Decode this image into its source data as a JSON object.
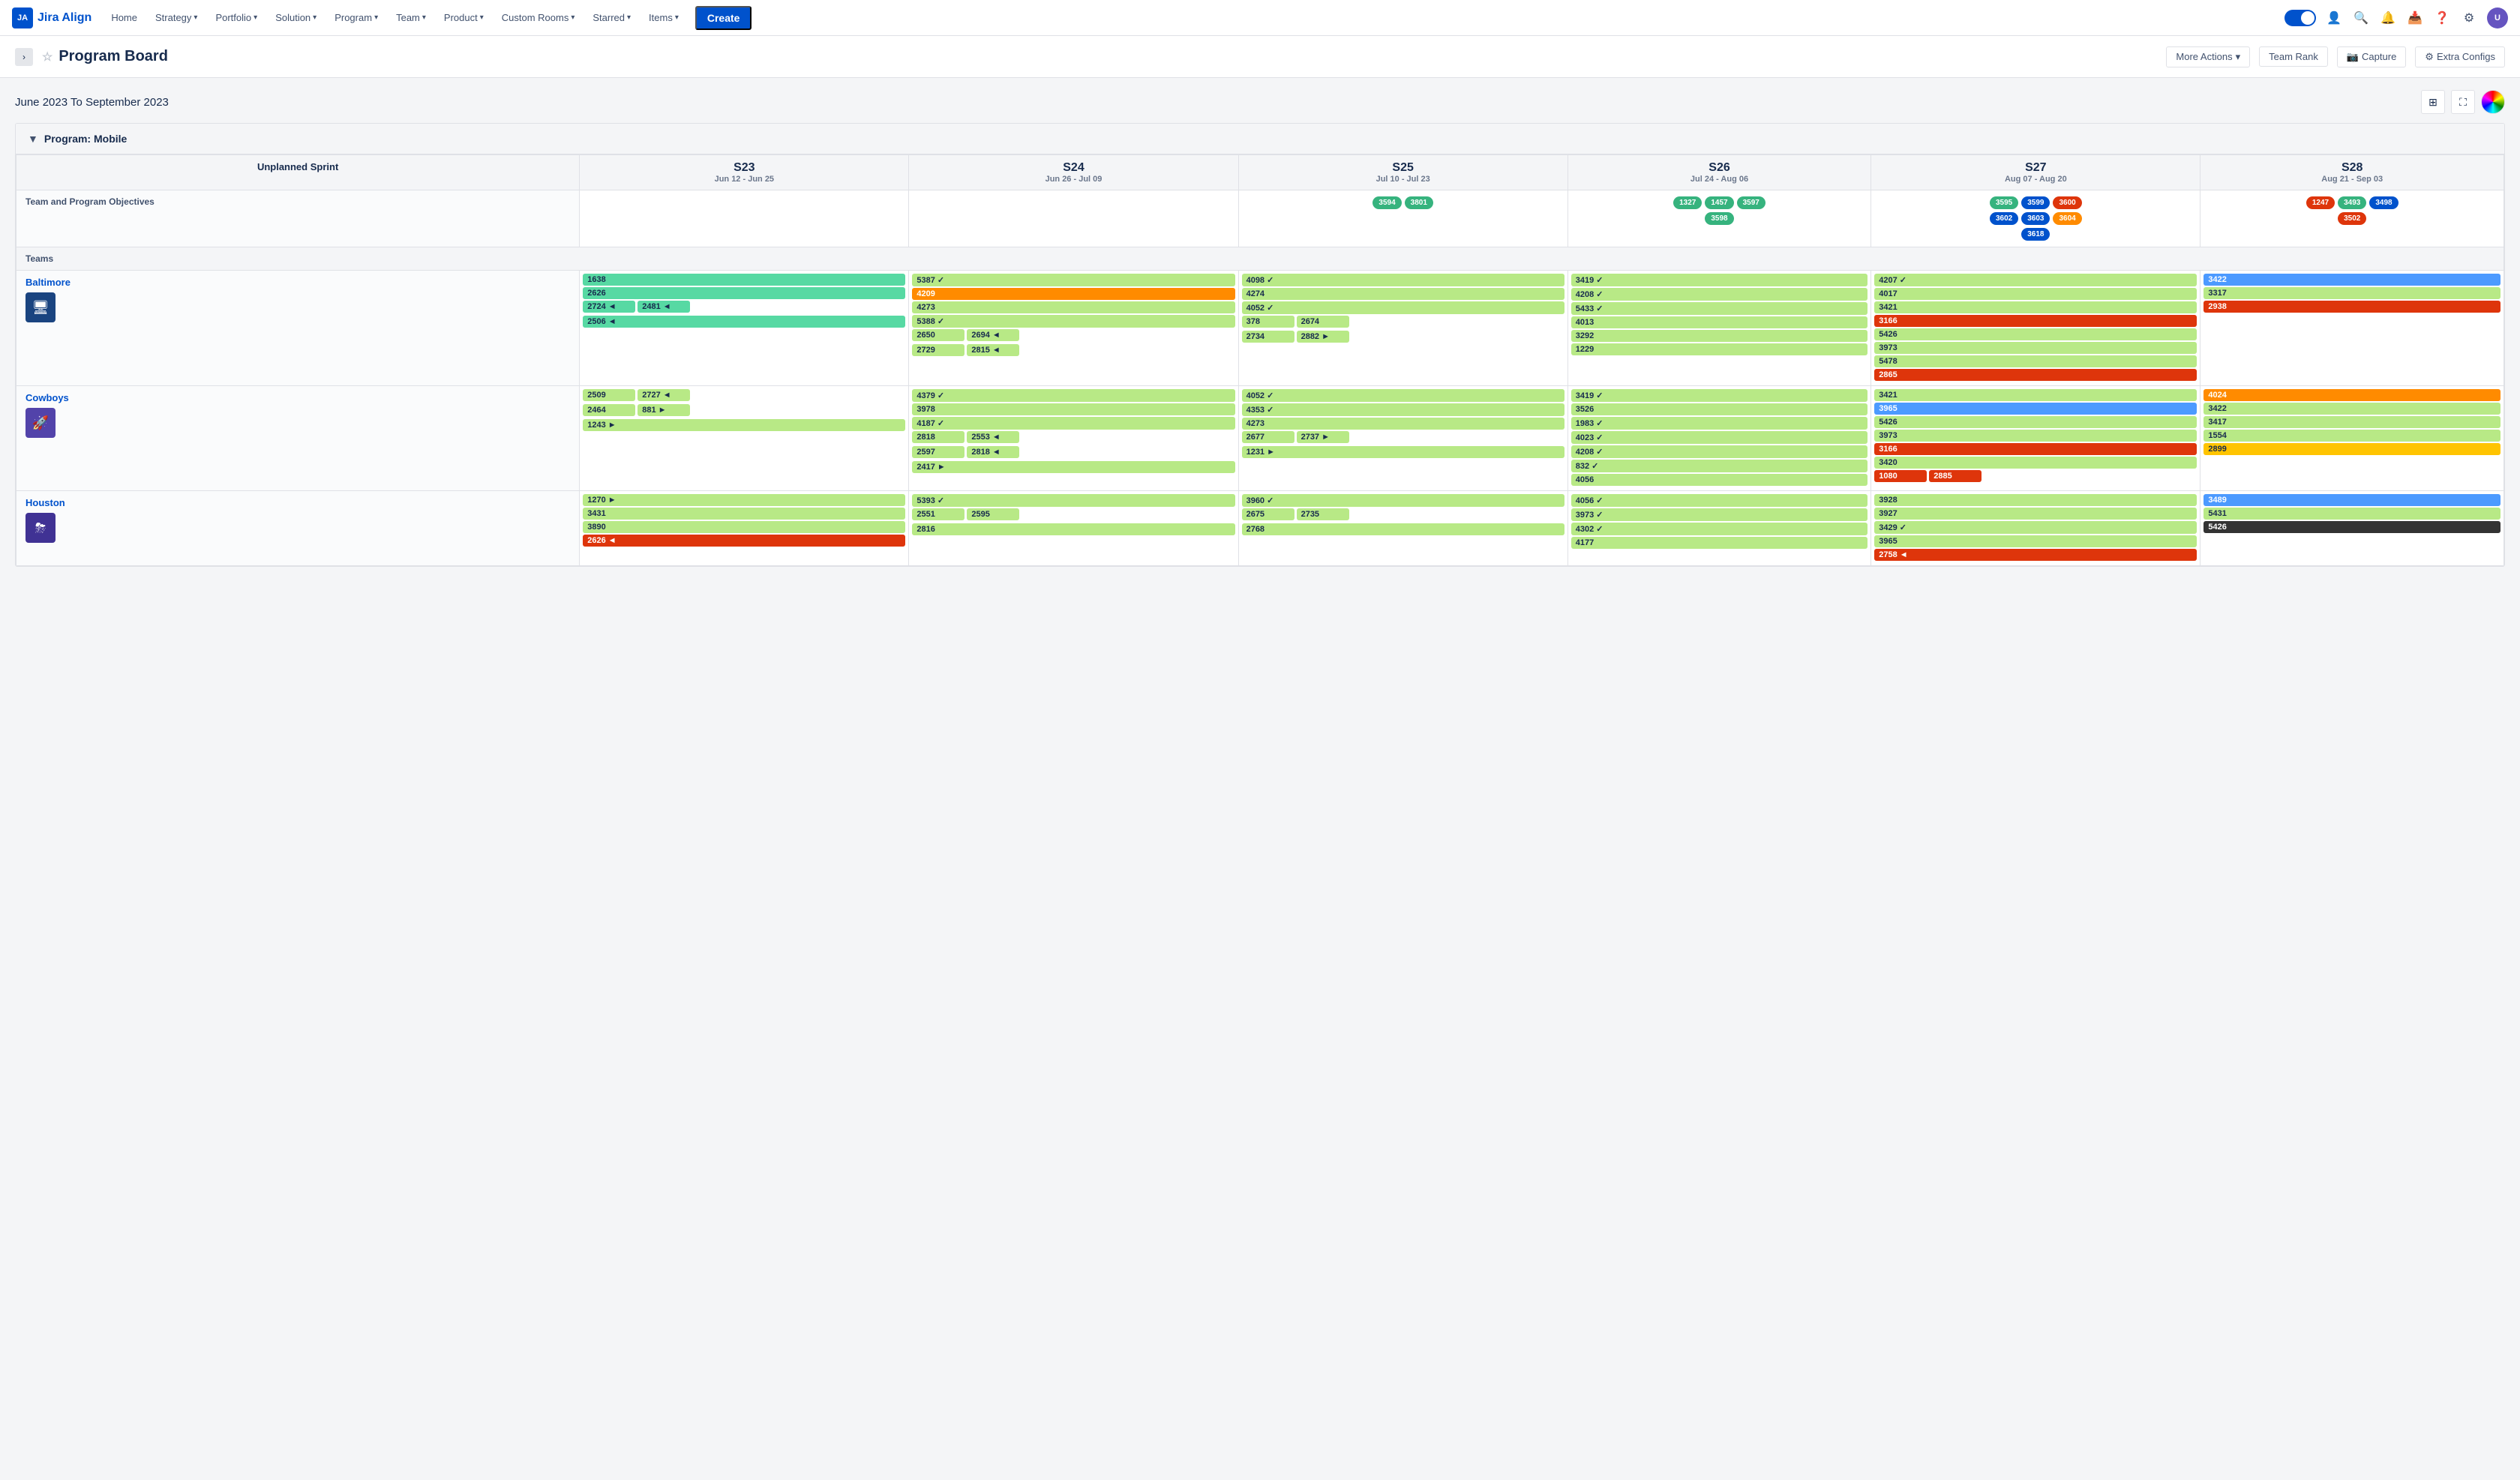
{
  "nav": {
    "logo_text": "Jira Align",
    "items": [
      {
        "label": "Home",
        "has_dropdown": false
      },
      {
        "label": "Strategy",
        "has_dropdown": true
      },
      {
        "label": "Portfolio",
        "has_dropdown": true
      },
      {
        "label": "Solution",
        "has_dropdown": true
      },
      {
        "label": "Program",
        "has_dropdown": true
      },
      {
        "label": "Team",
        "has_dropdown": true
      },
      {
        "label": "Product",
        "has_dropdown": true
      },
      {
        "label": "Custom Rooms",
        "has_dropdown": true
      },
      {
        "label": "Starred",
        "has_dropdown": true
      },
      {
        "label": "Items",
        "has_dropdown": true
      }
    ],
    "create_label": "Create"
  },
  "page": {
    "title": "Program Board",
    "more_actions": "More Actions",
    "team_rank": "Team Rank",
    "capture": "Capture",
    "extra_configs": "Extra Configs"
  },
  "date_range": "June 2023 To September 2023",
  "program_label": "Program: Mobile",
  "sprints": [
    {
      "code": "S23",
      "dates": "Jun 12 - Jun 25"
    },
    {
      "code": "S24",
      "dates": "Jun 26 - Jul 09"
    },
    {
      "code": "S25",
      "dates": "Jul 10 - Jul 23"
    },
    {
      "code": "S26",
      "dates": "Jul 24 - Aug 06"
    },
    {
      "code": "S27",
      "dates": "Aug 07 - Aug 20"
    },
    {
      "code": "S28",
      "dates": "Aug 21 - Sep 03"
    }
  ],
  "unplanned_sprint_label": "Unplanned Sprint",
  "sections": {
    "objectives_label": "Team and Program Objectives",
    "teams_label": "Teams"
  },
  "objectives": {
    "s23": [],
    "s24": [],
    "s25": [
      {
        "id": "3594",
        "color": "green"
      },
      {
        "id": "3801",
        "color": "green"
      }
    ],
    "s26": [
      {
        "id": "1327",
        "color": "green"
      },
      {
        "id": "1457",
        "color": "green"
      },
      {
        "id": "3597",
        "color": "green"
      },
      {
        "id": "3598",
        "color": "green"
      }
    ],
    "s27": [
      {
        "id": "3595",
        "color": "green"
      },
      {
        "id": "3599",
        "color": "blue"
      },
      {
        "id": "3600",
        "color": "red"
      },
      {
        "id": "3602",
        "color": "blue"
      },
      {
        "id": "3603",
        "color": "blue"
      },
      {
        "id": "3604",
        "color": "orange"
      },
      {
        "id": "3618",
        "color": "blue"
      }
    ],
    "s28": [
      {
        "id": "1247",
        "color": "red"
      },
      {
        "id": "3493",
        "color": "green"
      },
      {
        "id": "3498",
        "color": "blue"
      },
      {
        "id": "3502",
        "color": "red"
      }
    ]
  },
  "teams": [
    {
      "name": "Baltimore",
      "avatar_icon": "🖥",
      "avatar_color": "dark-blue",
      "sprints": {
        "s23": [
          [
            {
              "id": "1638",
              "color": "green"
            }
          ],
          [
            {
              "id": "2626",
              "color": "green"
            }
          ],
          [
            {
              "id": "2724",
              "color": "green"
            },
            {
              "id": "2481",
              "color": "green"
            }
          ],
          [
            {
              "id": "2506",
              "color": "green",
              "arrow": "◄"
            }
          ]
        ],
        "s24": [
          [
            {
              "id": "5387",
              "color": "lime",
              "arrow": "✓"
            }
          ],
          [
            {
              "id": "4209",
              "color": "orange"
            }
          ],
          [
            {
              "id": "4273",
              "color": "lime"
            }
          ],
          [
            {
              "id": "5388",
              "color": "lime",
              "arrow": "✓"
            }
          ],
          [
            {
              "id": "2650",
              "color": "lime"
            },
            {
              "id": "2694",
              "color": "lime"
            }
          ],
          [
            {
              "id": "2729",
              "color": "lime"
            },
            {
              "id": "2815",
              "color": "lime"
            }
          ]
        ],
        "s25": [
          [
            {
              "id": "4098",
              "color": "lime",
              "arrow": "✓"
            }
          ],
          [
            {
              "id": "4274",
              "color": "lime"
            }
          ],
          [
            {
              "id": "4052",
              "color": "lime",
              "arrow": "✓"
            }
          ],
          [
            {
              "id": "378",
              "color": "lime"
            },
            {
              "id": "2674",
              "color": "lime"
            }
          ],
          [
            {
              "id": "2734",
              "color": "lime"
            },
            {
              "id": "2882",
              "color": "lime",
              "arrow": "►"
            }
          ]
        ],
        "s26": [
          [
            {
              "id": "3419",
              "color": "lime",
              "arrow": "✓"
            }
          ],
          [
            {
              "id": "4208",
              "color": "lime",
              "arrow": "✓"
            }
          ],
          [
            {
              "id": "5433",
              "color": "lime",
              "arrow": "✓"
            }
          ],
          [
            {
              "id": "4013",
              "color": "lime"
            }
          ],
          [
            {
              "id": "3292",
              "color": "lime"
            }
          ],
          [
            {
              "id": "1229",
              "color": "lime"
            }
          ]
        ],
        "s27": [
          [
            {
              "id": "4207",
              "color": "lime",
              "arrow": "✓"
            }
          ],
          [
            {
              "id": "4017",
              "color": "lime"
            }
          ],
          [
            {
              "id": "3421",
              "color": "lime"
            }
          ],
          [
            {
              "id": "3166",
              "color": "red"
            }
          ],
          [
            {
              "id": "5426",
              "color": "lime"
            }
          ],
          [
            {
              "id": "3973",
              "color": "lime"
            }
          ],
          [
            {
              "id": "5478",
              "color": "lime"
            }
          ],
          [
            {
              "id": "2865",
              "color": "red"
            }
          ]
        ],
        "s28": [
          [
            {
              "id": "3422",
              "color": "blue"
            }
          ],
          [
            {
              "id": "3317",
              "color": "lime"
            }
          ],
          [
            {
              "id": "2938",
              "color": "red"
            }
          ]
        ]
      }
    },
    {
      "name": "Cowboys",
      "avatar_icon": "🚀",
      "avatar_color": "purple",
      "sprints": {
        "s23": [
          [
            {
              "id": "2509",
              "color": "lime"
            },
            {
              "id": "2727",
              "color": "lime",
              "arrow": "◄"
            }
          ],
          [
            {
              "id": "2464",
              "color": "lime"
            },
            {
              "id": "881",
              "color": "lime",
              "arrow": "►"
            }
          ],
          [
            {
              "id": "1243",
              "color": "lime",
              "arrow": "►"
            }
          ]
        ],
        "s24": [
          [
            {
              "id": "4379",
              "color": "lime",
              "arrow": "✓"
            }
          ],
          [
            {
              "id": "3978",
              "color": "lime"
            }
          ],
          [
            {
              "id": "4187",
              "color": "lime",
              "arrow": "✓"
            }
          ],
          [
            {
              "id": "2818",
              "color": "lime"
            },
            {
              "id": "2553",
              "color": "lime"
            }
          ],
          [
            {
              "id": "2597",
              "color": "lime"
            },
            {
              "id": "2818",
              "color": "lime"
            }
          ],
          [
            {
              "id": "2417",
              "color": "lime",
              "arrow": "►"
            }
          ]
        ],
        "s25": [
          [
            {
              "id": "4052",
              "color": "lime",
              "arrow": "✓"
            }
          ],
          [
            {
              "id": "4353",
              "color": "lime",
              "arrow": "✓"
            }
          ],
          [
            {
              "id": "4273",
              "color": "lime"
            }
          ],
          [
            {
              "id": "2677",
              "color": "lime"
            },
            {
              "id": "2737",
              "color": "lime",
              "arrow": "►"
            }
          ],
          [
            {
              "id": "1231",
              "color": "lime",
              "arrow": "►"
            }
          ]
        ],
        "s26": [
          [
            {
              "id": "3419",
              "color": "lime",
              "arrow": "✓"
            }
          ],
          [
            {
              "id": "3526",
              "color": "lime"
            }
          ],
          [
            {
              "id": "1983",
              "color": "lime",
              "arrow": "✓"
            }
          ],
          [
            {
              "id": "4023",
              "color": "lime",
              "arrow": "✓"
            }
          ],
          [
            {
              "id": "4208",
              "color": "lime",
              "arrow": "✓"
            }
          ],
          [
            {
              "id": "832",
              "color": "lime",
              "arrow": "✓"
            }
          ],
          [
            {
              "id": "4056",
              "color": "lime"
            }
          ]
        ],
        "s27": [
          [
            {
              "id": "3421",
              "color": "lime"
            }
          ],
          [
            {
              "id": "3965",
              "color": "blue"
            }
          ],
          [
            {
              "id": "5426",
              "color": "lime"
            }
          ],
          [
            {
              "id": "3973",
              "color": "lime"
            }
          ],
          [
            {
              "id": "3166",
              "color": "red"
            }
          ],
          [
            {
              "id": "3420",
              "color": "lime"
            }
          ],
          [
            {
              "id": "1080",
              "color": "red"
            },
            {
              "id": "2885",
              "color": "red"
            }
          ]
        ],
        "s28": [
          [
            {
              "id": "4024",
              "color": "orange"
            }
          ],
          [
            {
              "id": "3422",
              "color": "lime"
            }
          ],
          [
            {
              "id": "3417",
              "color": "lime"
            }
          ],
          [
            {
              "id": "1554",
              "color": "lime"
            }
          ],
          [
            {
              "id": "2899",
              "color": "yellow"
            }
          ]
        ]
      }
    },
    {
      "name": "Houston",
      "avatar_icon": "⛈",
      "avatar_color": "indigo",
      "sprints": {
        "s23": [
          [
            {
              "id": "1270",
              "color": "lime",
              "arrow": "►"
            }
          ],
          [
            {
              "id": "3431",
              "color": "lime"
            }
          ],
          [
            {
              "id": "3890",
              "color": "lime"
            }
          ],
          [
            {
              "id": "2626",
              "color": "red",
              "arrow": "◄"
            }
          ]
        ],
        "s24": [
          [
            {
              "id": "5393",
              "color": "lime",
              "arrow": "✓"
            }
          ],
          [
            {
              "id": "2551",
              "color": "lime"
            },
            {
              "id": "2595",
              "color": "lime"
            }
          ],
          [
            {
              "id": "2816",
              "color": "lime"
            }
          ]
        ],
        "s25": [
          [
            {
              "id": "3960",
              "color": "lime",
              "arrow": "✓"
            }
          ],
          [
            {
              "id": "2675",
              "color": "lime"
            },
            {
              "id": "2735",
              "color": "lime"
            }
          ],
          [
            {
              "id": "2768",
              "color": "lime"
            }
          ]
        ],
        "s26": [
          [
            {
              "id": "4056",
              "color": "lime",
              "arrow": "✓"
            }
          ],
          [
            {
              "id": "3973",
              "color": "lime",
              "arrow": "✓"
            }
          ],
          [
            {
              "id": "4302",
              "color": "lime",
              "arrow": "✓"
            }
          ],
          [
            {
              "id": "4177",
              "color": "lime"
            }
          ]
        ],
        "s27": [
          [
            {
              "id": "3928",
              "color": "lime"
            }
          ],
          [
            {
              "id": "3927",
              "color": "lime"
            }
          ],
          [
            {
              "id": "3429",
              "color": "lime",
              "arrow": "✓"
            }
          ],
          [
            {
              "id": "3965",
              "color": "lime"
            }
          ],
          [
            {
              "id": "2758",
              "color": "red",
              "arrow": "◄"
            }
          ]
        ],
        "s28": [
          [
            {
              "id": "3489",
              "color": "blue"
            }
          ],
          [
            {
              "id": "5431",
              "color": "lime"
            }
          ],
          [
            {
              "id": "5426",
              "color": "dark"
            }
          ]
        ]
      }
    }
  ]
}
